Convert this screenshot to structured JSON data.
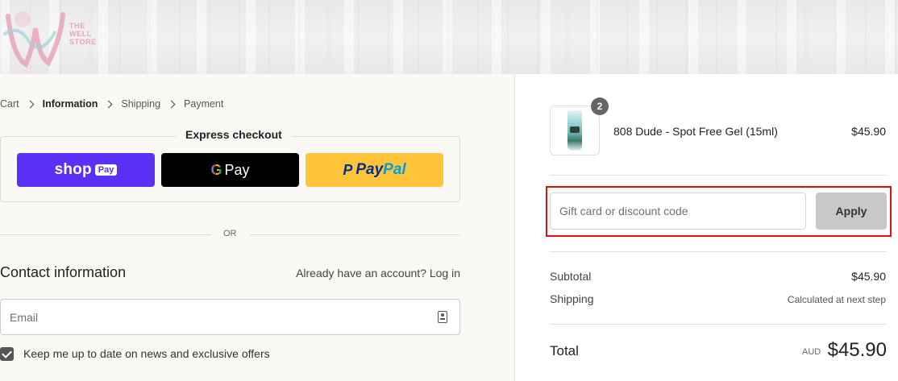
{
  "brand": {
    "logo_line1": "THE",
    "logo_line2": "WELL",
    "logo_line3": "STORE",
    "accent_color": "#e8a5b8"
  },
  "breadcrumb": {
    "items": [
      {
        "label": "Cart",
        "current": false
      },
      {
        "label": "Information",
        "current": true
      },
      {
        "label": "Shipping",
        "current": false
      },
      {
        "label": "Payment",
        "current": false
      }
    ]
  },
  "express_checkout": {
    "title": "Express checkout",
    "shop_pay": {
      "word": "shop",
      "badge": "Pay",
      "color": "#5a31f4"
    },
    "google_pay": {
      "g": "G",
      "word": "Pay",
      "color": "#000000"
    },
    "paypal": {
      "icon": "P",
      "word_a": "Pay",
      "word_b": "Pal",
      "color": "#ffc439"
    }
  },
  "separator": {
    "label": "OR"
  },
  "contact": {
    "title": "Contact information",
    "account_prompt": "Already have an account?",
    "login_link": "Log in",
    "email_placeholder": "Email",
    "newsletter_label": "Keep me up to date on news and exclusive offers",
    "newsletter_checked": true
  },
  "order": {
    "item": {
      "name": "808 Dude - Spot Free Gel (15ml)",
      "price": "$45.90",
      "quantity": "2"
    },
    "discount": {
      "placeholder": "Gift card or discount code",
      "apply_label": "Apply"
    },
    "subtotal_label": "Subtotal",
    "subtotal_value": "$45.90",
    "shipping_label": "Shipping",
    "shipping_value": "Calculated at next step",
    "total_label": "Total",
    "total_currency": "AUD",
    "total_value": "$45.90"
  }
}
